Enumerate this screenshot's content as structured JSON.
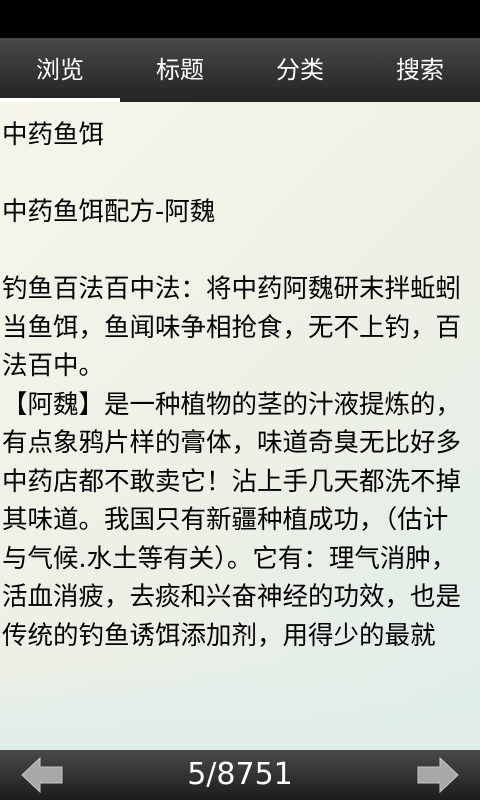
{
  "tabs": [
    {
      "label": "浏览",
      "active": true
    },
    {
      "label": "标题",
      "active": false
    },
    {
      "label": "分类",
      "active": false
    },
    {
      "label": "搜索",
      "active": false
    }
  ],
  "content": {
    "title": "中药鱼饵",
    "subtitle": "中药鱼饵配方-阿魏",
    "paragraph1": "钓鱼百法百中法：将中药阿魏研末拌蚯蚓当鱼饵，鱼闻味争相抢食，无不上钓，百法百中。",
    "paragraph2": "【阿魏】是一种植物的茎的汁液提炼的，有点象鸦片样的膏体，味道奇臭无比好多中药店都不敢卖它！沾上手几天都洗不掉其味道。我国只有新疆种植成功，（估计与气候.水土等有关）。它有：理气消肿，活血消疲，去痰和兴奋神经的功效，也是传统的钓鱼诱饵添加剂，用得少的最就"
  },
  "footer": {
    "page_indicator": "5/8751",
    "prev_icon": "arrow-left-icon",
    "next_icon": "arrow-right-icon"
  },
  "colors": {
    "tab_bar_top": "#474747",
    "tab_bar_bottom": "#242424",
    "content_bg_start": "#f6f5ea",
    "content_bg_end": "#dfeee8",
    "arrow": "#a8a8a8"
  }
}
